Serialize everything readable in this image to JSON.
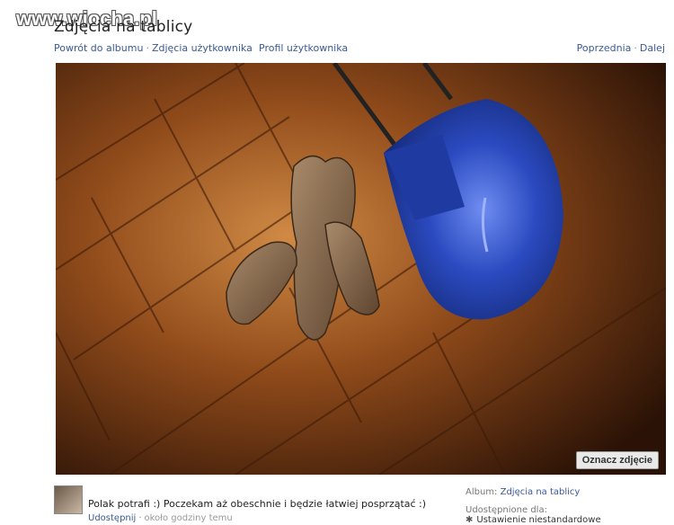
{
  "watermark": "www.wiocha.pl",
  "page_title": "Zdjęcia na tablicy",
  "nav": {
    "back_to_album": "Powrót do albumu",
    "separator": "·",
    "user_photos": "Zdjęcia użytkownika",
    "profile": "Profil użytkownika",
    "previous": "Poprzednia",
    "next": "Dalej"
  },
  "photo": {
    "tag_button": "Oznacz zdjęcie"
  },
  "post": {
    "caption": "Polak potrafi :) Poczekam aż obeschnie i będzie łatwiej posprzątać :)",
    "share": "Udostępnij",
    "separator": "·",
    "time": "około godziny temu"
  },
  "side": {
    "album_label": "Album:",
    "album_name": "Zdjęcia na tablicy",
    "shared_label": "Udostępnione dla:",
    "privacy": "Ustawienie niestandardowe"
  },
  "colors": {
    "link": "#3b5998",
    "wood": "#8a4a1c",
    "hair_dryer": "#2a4bbf"
  }
}
